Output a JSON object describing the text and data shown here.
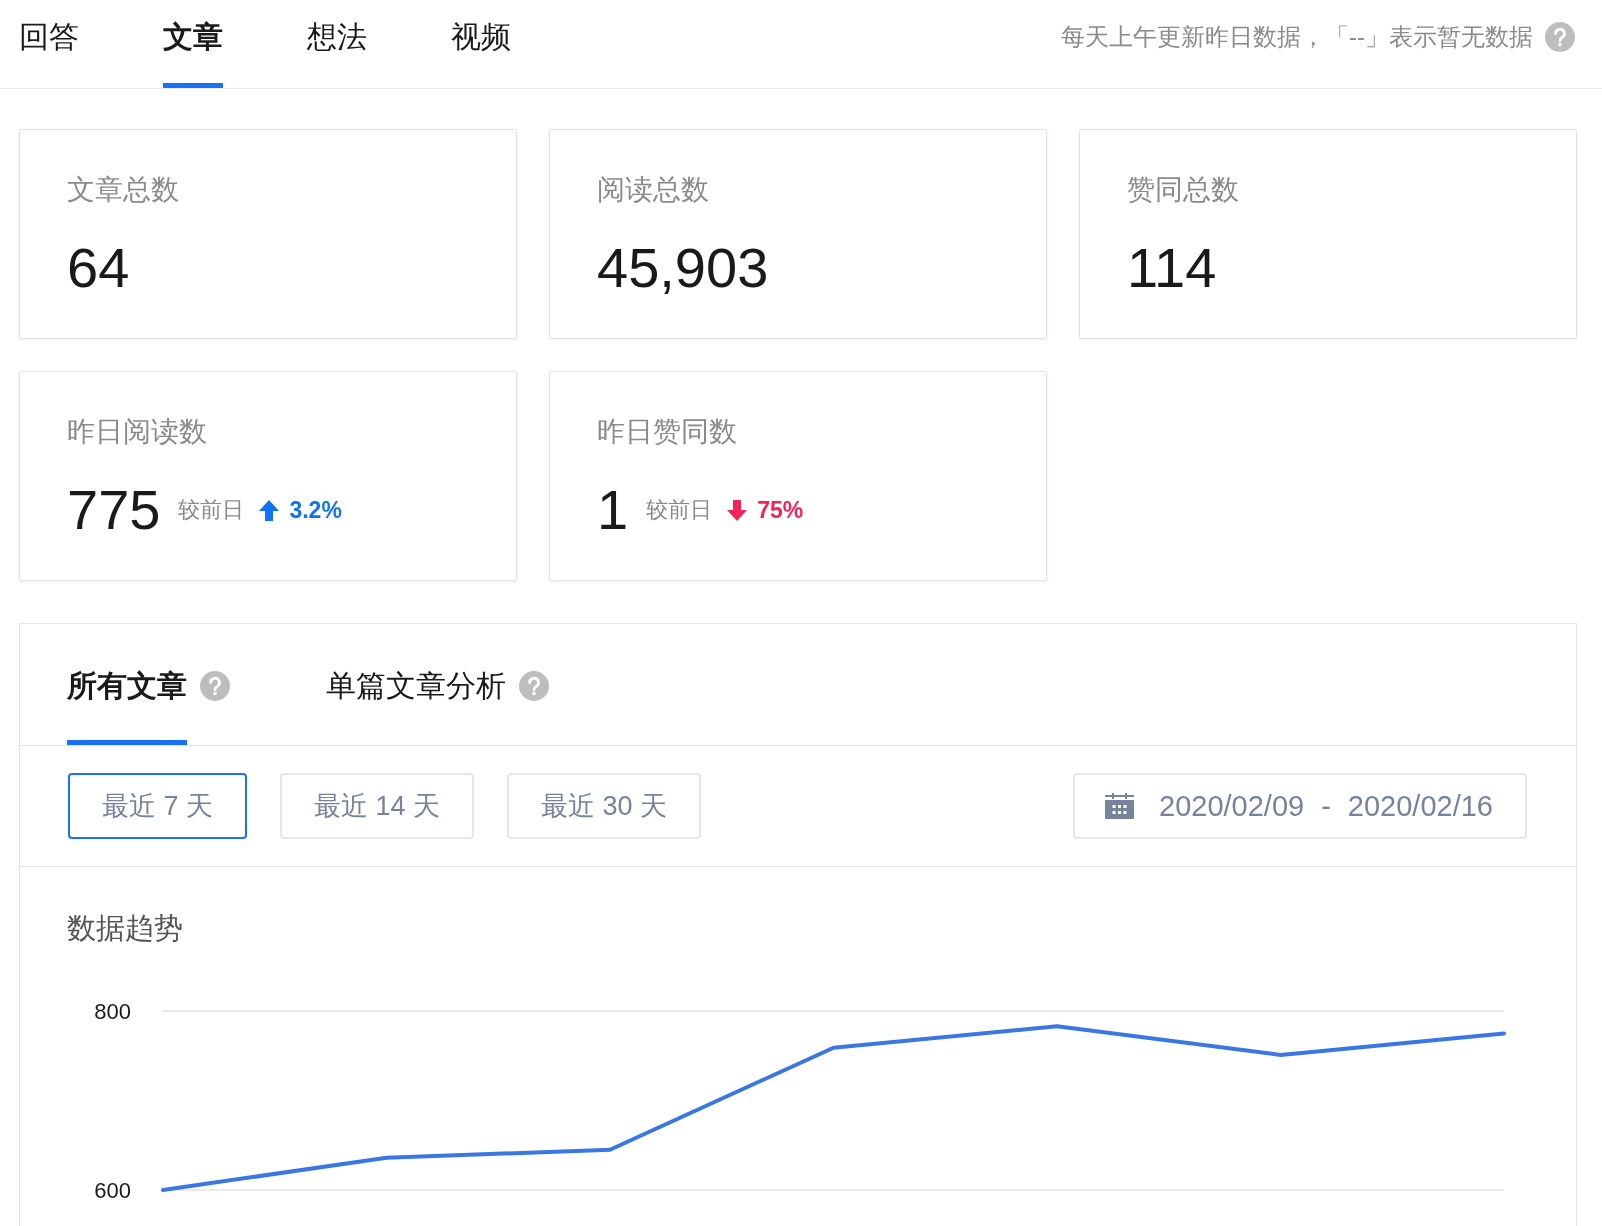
{
  "tabs": [
    {
      "label": "回答",
      "selected": false
    },
    {
      "label": "文章",
      "selected": true
    },
    {
      "label": "想法",
      "selected": false
    },
    {
      "label": "视频",
      "selected": false
    }
  ],
  "notice": "每天上午更新昨日数据，「--」表示暂无数据",
  "stats": [
    {
      "label": "文章总数",
      "value": "64"
    },
    {
      "label": "阅读总数",
      "value": "45,903"
    },
    {
      "label": "赞同总数",
      "value": "114"
    },
    {
      "label": "昨日阅读数",
      "value": "775",
      "compare_label": "较前日",
      "rising": true,
      "change": "3.2%"
    },
    {
      "label": "昨日赞同数",
      "value": "1",
      "compare_label": "较前日",
      "rising": false,
      "change": "75%"
    }
  ],
  "analysis": {
    "tabs": [
      {
        "label": "所有文章",
        "selected": true
      },
      {
        "label": "单篇文章分析",
        "selected": false
      }
    ],
    "ranges": [
      {
        "label": "最近 7 天",
        "selected": true
      },
      {
        "label": "最近 14 天",
        "selected": false
      },
      {
        "label": "最近 30 天",
        "selected": false
      }
    ],
    "date_range": {
      "start": "2020/02/09",
      "separator": "-",
      "end": "2020/02/16"
    },
    "chart_data": {
      "type": "line",
      "title": "数据趋势",
      "values": [
        600,
        636,
        645,
        759,
        783,
        751,
        775
      ],
      "ylim": [
        600,
        800
      ],
      "yticks": [
        600,
        800
      ]
    }
  }
}
